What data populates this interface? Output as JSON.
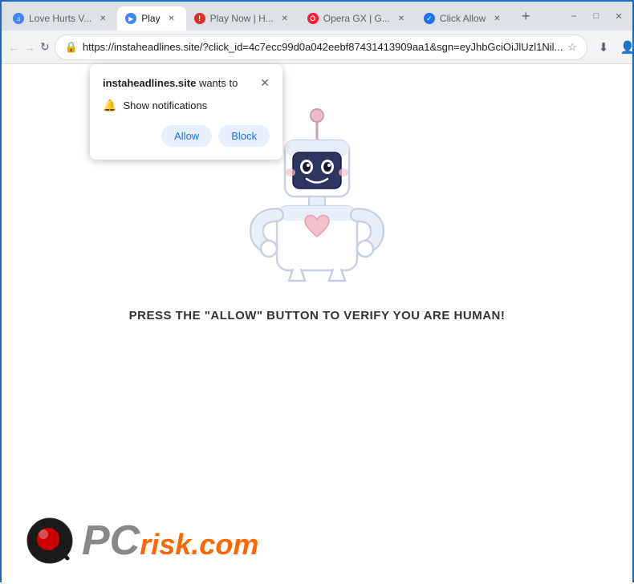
{
  "titlebar": {
    "tabs": [
      {
        "id": "tab1",
        "label": "Love Hurts V...",
        "favicon": "♫",
        "favicon_color": "fav-blue",
        "active": false
      },
      {
        "id": "tab2",
        "label": "Play",
        "favicon": "▶",
        "favicon_color": "fav-blue",
        "active": true
      },
      {
        "id": "tab3",
        "label": "Play Now | H...",
        "favicon": "!",
        "favicon_color": "fav-red",
        "active": false
      },
      {
        "id": "tab4",
        "label": "Opera GX | G...",
        "favicon": "O",
        "favicon_color": "fav-opera",
        "active": false
      },
      {
        "id": "tab5",
        "label": "Click Allow",
        "favicon": "✓",
        "favicon_color": "fav-click",
        "active": false
      }
    ],
    "new_tab_label": "+",
    "minimize_label": "–",
    "maximize_label": "□",
    "close_label": "✕"
  },
  "addressbar": {
    "back_icon": "←",
    "forward_icon": "→",
    "refresh_icon": "↻",
    "url": "https://instaheadlines.site/?click_id=4c7ecc99d0a042eebf87431413909aa1&sgn=eyJhbGciOiJlUzl1Nil...",
    "bookmark_icon": "☆",
    "download_icon": "⬇",
    "profile_icon": "👤",
    "menu_icon": "⋮"
  },
  "notification_popup": {
    "site_name": "instaheadlines.site",
    "wants_to_text": " wants to",
    "close_icon": "✕",
    "bell_icon": "🔔",
    "notification_label": "Show notifications",
    "allow_label": "Allow",
    "block_label": "Block"
  },
  "page": {
    "press_text": "PRESS THE \"ALLOW\" BUTTON TO VERIFY YOU ARE HUMAN!"
  },
  "footer": {
    "pc_text": "PC",
    "risk_text": "risk.com"
  }
}
